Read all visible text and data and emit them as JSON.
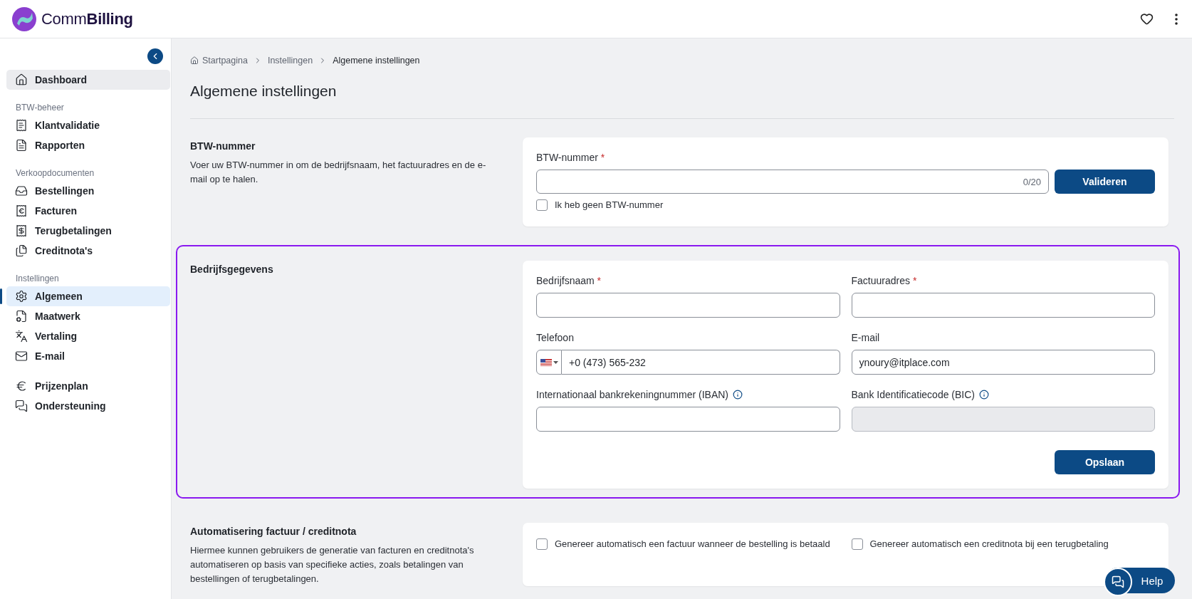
{
  "header": {
    "logo_text_light": "Comm",
    "logo_text_bold": "Billing"
  },
  "sidebar": {
    "groups": [
      {
        "items": [
          {
            "label": "Dashboard",
            "selected": false,
            "hovered": true
          }
        ]
      },
      {
        "title": "BTW-beheer",
        "items": [
          {
            "label": "Klantvalidatie",
            "selected": false
          },
          {
            "label": "Rapporten",
            "selected": false
          }
        ]
      },
      {
        "title": "Verkoopdocumenten",
        "items": [
          {
            "label": "Bestellingen",
            "selected": false
          },
          {
            "label": "Facturen",
            "selected": false
          },
          {
            "label": "Terugbetalingen",
            "selected": false
          },
          {
            "label": "Creditnota's",
            "selected": false
          }
        ]
      },
      {
        "title": "Instellingen",
        "items": [
          {
            "label": "Algemeen",
            "selected": true
          },
          {
            "label": "Maatwerk",
            "selected": false
          },
          {
            "label": "Vertaling",
            "selected": false
          },
          {
            "label": "E-mail",
            "selected": false
          }
        ]
      },
      {
        "items": [
          {
            "label": "Prijzenplan",
            "selected": false
          },
          {
            "label": "Ondersteuning",
            "selected": false
          }
        ]
      }
    ]
  },
  "breadcrumb": [
    {
      "label": "Startpagina",
      "current": false
    },
    {
      "label": "Instellingen",
      "current": false
    },
    {
      "label": "Algemene instellingen",
      "current": true
    }
  ],
  "page_title": "Algemene instellingen",
  "vat_section": {
    "title": "BTW-nummer",
    "description": "Voer uw BTW-nummer in om de bedrijfsnaam, het factuuradres en de e-mail op te halen.",
    "label": "BTW-nummer",
    "required_mark": "*",
    "counter": "0/20",
    "button": "Valideren",
    "checkbox": {
      "label": "Ik heb geen BTW-nummer",
      "checked": false
    }
  },
  "company_section": {
    "title": "Bedrijfsgegevens",
    "highlighted": true,
    "fields": [
      {
        "kind": "text",
        "label": "Bedrijfsnaam",
        "required_mark": "*"
      },
      {
        "kind": "text",
        "label": "Factuuradres",
        "required_mark": "*"
      },
      {
        "kind": "phone",
        "label": "Telefoon",
        "value": "+0 (473) 565-232"
      },
      {
        "kind": "text",
        "label": "E-mail",
        "value": "ynoury@itplace.com"
      },
      {
        "kind": "text",
        "label": "Internationaal bankrekeningnummer (IBAN)",
        "info": true
      },
      {
        "kind": "text",
        "label": "Bank Identificatiecode (BIC)",
        "info": true,
        "disabled": true
      }
    ],
    "button": "Opslaan"
  },
  "automation_section": {
    "title": "Automatisering factuur / creditnota",
    "description": "Hiermee kunnen gebruikers de generatie van facturen en creditnota's automatiseren op basis van specifieke acties, zoals betalingen van bestellingen of terugbetalingen.",
    "options": [
      {
        "label": "Genereer automatisch een factuur wanneer de bestelling is betaald",
        "checked": false
      },
      {
        "label": "Genereer automatisch een creditnota bij een terugbetaling",
        "checked": false
      }
    ]
  },
  "help_button": "Help"
}
